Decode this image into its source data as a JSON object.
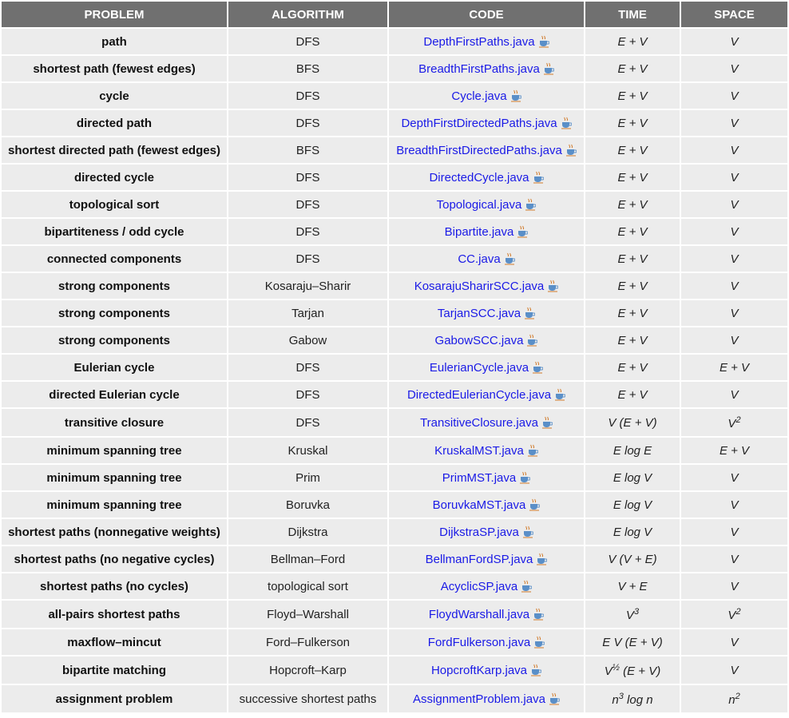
{
  "header": [
    "PROBLEM",
    "ALGORITHM",
    "CODE",
    "TIME",
    "SPACE"
  ],
  "rows": [
    {
      "problem": "path",
      "algorithm": "DFS",
      "code": "DepthFirstPaths.java",
      "time": "E + V",
      "space": "V"
    },
    {
      "problem": "shortest path (fewest edges)",
      "algorithm": "BFS",
      "code": "BreadthFirstPaths.java",
      "time": "E + V",
      "space": "V"
    },
    {
      "problem": "cycle",
      "algorithm": "DFS",
      "code": "Cycle.java",
      "time": "E + V",
      "space": "V"
    },
    {
      "problem": "directed path",
      "algorithm": "DFS",
      "code": "DepthFirstDirectedPaths.java",
      "time": "E + V",
      "space": "V"
    },
    {
      "problem": "shortest directed path (fewest edges)",
      "algorithm": "BFS",
      "code": "BreadthFirstDirectedPaths.java",
      "time": "E + V",
      "space": "V"
    },
    {
      "problem": "directed cycle",
      "algorithm": "DFS",
      "code": "DirectedCycle.java",
      "time": "E + V",
      "space": "V"
    },
    {
      "problem": "topological sort",
      "algorithm": "DFS",
      "code": "Topological.java",
      "time": "E + V",
      "space": "V"
    },
    {
      "problem": "bipartiteness / odd cycle",
      "algorithm": "DFS",
      "code": "Bipartite.java",
      "time": "E + V",
      "space": "V"
    },
    {
      "problem": "connected components",
      "algorithm": "DFS",
      "code": "CC.java",
      "time": "E + V",
      "space": "V"
    },
    {
      "problem": "strong components",
      "algorithm": "Kosaraju–Sharir",
      "code": "KosarajuSharirSCC.java",
      "time": "E + V",
      "space": "V"
    },
    {
      "problem": "strong components",
      "algorithm": "Tarjan",
      "code": "TarjanSCC.java",
      "time": "E + V",
      "space": "V"
    },
    {
      "problem": "strong components",
      "algorithm": "Gabow",
      "code": "GabowSCC.java",
      "time": "E + V",
      "space": "V"
    },
    {
      "problem": "Eulerian cycle",
      "algorithm": "DFS",
      "code": "EulerianCycle.java",
      "time": "E + V",
      "space": "E + V"
    },
    {
      "problem": "directed Eulerian cycle",
      "algorithm": "DFS",
      "code": "DirectedEulerianCycle.java",
      "time": "E + V",
      "space": "V"
    },
    {
      "problem": "transitive closure",
      "algorithm": "DFS",
      "code": "TransitiveClosure.java",
      "time": "V (E + V)",
      "space": "V",
      "space_sup": "2"
    },
    {
      "problem": "minimum spanning tree",
      "algorithm": "Kruskal",
      "code": "KruskalMST.java",
      "time": "E log E",
      "space": "E + V"
    },
    {
      "problem": "minimum spanning tree",
      "algorithm": "Prim",
      "code": "PrimMST.java",
      "time": "E log V",
      "space": "V"
    },
    {
      "problem": "minimum spanning tree",
      "algorithm": "Boruvka",
      "code": "BoruvkaMST.java",
      "time": "E log V",
      "space": "V"
    },
    {
      "problem": "shortest paths (nonnegative weights)",
      "algorithm": "Dijkstra",
      "code": "DijkstraSP.java",
      "time": "E log V",
      "space": "V"
    },
    {
      "problem": "shortest paths (no negative cycles)",
      "algorithm": "Bellman–Ford",
      "code": "BellmanFordSP.java",
      "time": "V (V + E)",
      "space": "V"
    },
    {
      "problem": "shortest paths (no cycles)",
      "algorithm": "topological sort",
      "code": "AcyclicSP.java",
      "time": "V + E",
      "space": "V"
    },
    {
      "problem": "all-pairs shortest paths",
      "algorithm": "Floyd–Warshall",
      "code": "FloydWarshall.java",
      "time": "V",
      "time_sup": "3",
      "space": "V",
      "space_sup": "2"
    },
    {
      "problem": "maxflow–mincut",
      "algorithm": "Ford–Fulkerson",
      "code": "FordFulkerson.java",
      "time": "E V (E + V)",
      "space": "V"
    },
    {
      "problem": "bipartite matching",
      "algorithm": "Hopcroft–Karp",
      "code": "HopcroftKarp.java",
      "time": "V",
      "time_sup": "½",
      "time_rest": " (E + V)",
      "space": "V"
    },
    {
      "problem": "assignment problem",
      "algorithm": "successive shortest paths",
      "code": "AssignmentProblem.java",
      "time": "n",
      "time_sup": "3",
      "time_rest": " log n",
      "space": "n",
      "space_sup": "2"
    }
  ],
  "icons": {
    "code_link": "java-coffee-cup-icon"
  },
  "colors": {
    "header_bg": "#707070",
    "cell_bg": "#ececec",
    "link": "#1a1ae6"
  }
}
